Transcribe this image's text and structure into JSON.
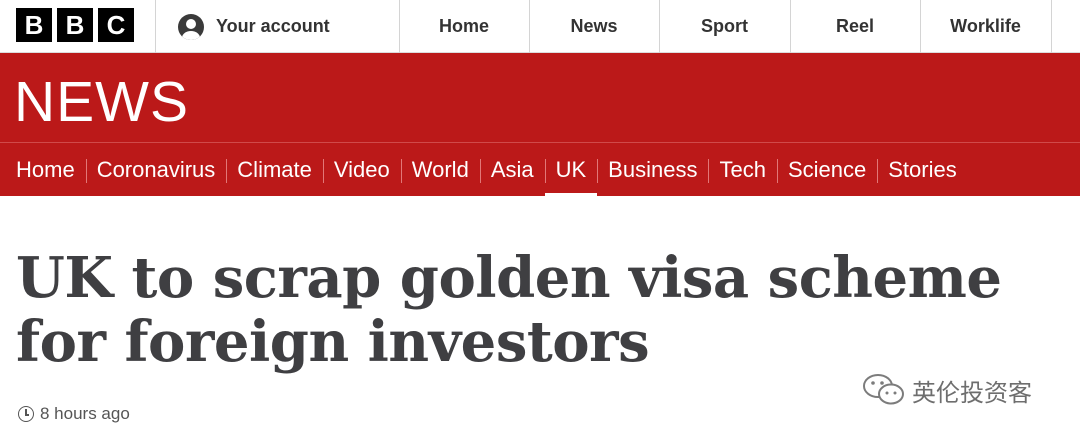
{
  "brand": {
    "logo_letters": [
      "B",
      "B",
      "C"
    ],
    "news_logo": "NEWS"
  },
  "account": {
    "label": "Your account",
    "icon": "user-icon"
  },
  "top_nav": [
    "Home",
    "News",
    "Sport",
    "Reel",
    "Worklife"
  ],
  "section_nav": {
    "items": [
      "Home",
      "Coronavirus",
      "Climate",
      "Video",
      "World",
      "Asia",
      "UK",
      "Business",
      "Tech",
      "Science",
      "Stories"
    ],
    "active": "UK"
  },
  "article": {
    "headline": "UK to scrap golden visa scheme for foreign investors",
    "timestamp": "8 hours ago",
    "timestamp_icon": "clock-icon"
  },
  "watermark": {
    "text": "英伦投资客",
    "icon": "wechat-icon"
  },
  "colors": {
    "brand_red": "#bb1919",
    "headline": "#3f3f42"
  }
}
